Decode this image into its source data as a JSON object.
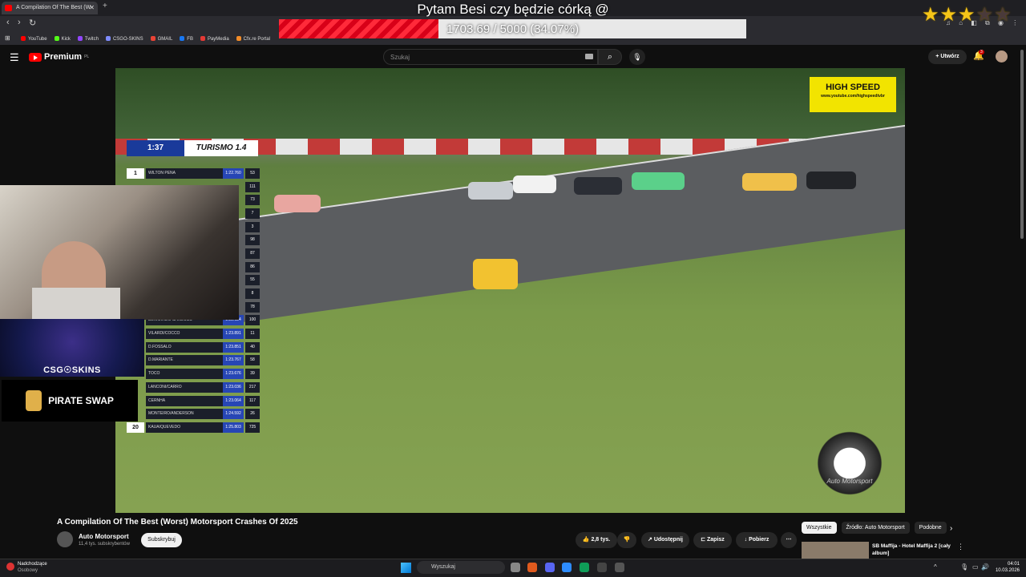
{
  "browser": {
    "tab_title": "A Compilation Of The Best (W",
    "new_tab": "+",
    "bookmarks": [
      {
        "label": "YouTube",
        "color": "#ff0000"
      },
      {
        "label": "Kick",
        "color": "#53fc18"
      },
      {
        "label": "Twitch",
        "color": "#9146ff"
      },
      {
        "label": "CSGO-SKINS",
        "color": "#7f8cff"
      },
      {
        "label": "GMAIL",
        "color": "#ea4335"
      },
      {
        "label": "FB",
        "color": "#1877f2"
      },
      {
        "label": "PayMedia",
        "color": "#e53935"
      },
      {
        "label": "Cfx.re Portal",
        "color": "#f28c28"
      }
    ]
  },
  "overlay": {
    "goal_title": "Pytam Besi czy będzie córką @",
    "goal_text": "1703.69 / 5000 (34.07%)",
    "goal_progress": 0.3407,
    "stars": {
      "filled": 3,
      "total": 5
    }
  },
  "youtube": {
    "logo_text": "Premium",
    "logo_region": "PL",
    "search_placeholder": "Szukaj",
    "create_label": "Utwórz",
    "notification_count": "3"
  },
  "video_overlay": {
    "timer": "1:37",
    "league": "TURISMO 1.4",
    "leaderboard": [
      {
        "pos": "1",
        "name": "WILTON PENA",
        "time": "1:22.760",
        "gap": "53"
      },
      {
        "pos": "",
        "name": "",
        "time": "",
        "gap": "111"
      },
      {
        "pos": "",
        "name": "",
        "time": "",
        "gap": "73"
      },
      {
        "pos": "",
        "name": "",
        "time": "",
        "gap": "7"
      },
      {
        "pos": "",
        "name": "",
        "time": "",
        "gap": "3"
      },
      {
        "pos": "",
        "name": "",
        "time": "",
        "gap": "98"
      },
      {
        "pos": "",
        "name": "",
        "time": "",
        "gap": "87"
      },
      {
        "pos": "",
        "name": "",
        "time": "",
        "gap": "86"
      },
      {
        "pos": "",
        "name": "",
        "time": "",
        "gap": "55"
      },
      {
        "pos": "",
        "name": "",
        "time": "",
        "gap": "8"
      },
      {
        "pos": "",
        "name": "",
        "time": "",
        "gap": "78"
      },
      {
        "pos": "",
        "name": "BERNARDO CARDOSO",
        "time": "1:22.634",
        "gap": "100"
      },
      {
        "pos": "",
        "name": "VILARDI/COCCO",
        "time": "1:23.891",
        "gap": "11"
      },
      {
        "pos": "",
        "name": "D.FOSSALO",
        "time": "1:23.851",
        "gap": "40"
      },
      {
        "pos": "",
        "name": "D.MARIANTE",
        "time": "1:23.767",
        "gap": "58"
      },
      {
        "pos": "",
        "name": "TOCO",
        "time": "1:23.676",
        "gap": "39"
      },
      {
        "pos": "",
        "name": "LANCONI/CARRO",
        "time": "1:23.036",
        "gap": "217"
      },
      {
        "pos": "",
        "name": "CERNHA",
        "time": "1:23.064",
        "gap": "117"
      },
      {
        "pos": "",
        "name": "MONTEIRO/ANDERSON",
        "time": "1:24.592",
        "gap": "26"
      },
      {
        "pos": "20",
        "name": "KAUA/QUEVEDO",
        "time": "1:25.803",
        "gap": "725"
      }
    ],
    "sponsor_logo": "HIGH SPEED",
    "sponsor_url": "www.youtube.com/highspeedtvbr",
    "channel_watermark": "Auto Motorsport"
  },
  "stream_overlays": {
    "csgo_label": "CSG☉SKINS",
    "pirate_label": "PIRATE SWAP"
  },
  "video": {
    "title": "A Compilation Of The Best (Worst) Motorsport Crashes Of 2025",
    "channel": "Auto Motorsport",
    "subscribers": "11,4 tys. subskrybentów",
    "subscribe_label": "Subskrybuj",
    "likes": "2,8 tys.",
    "share_label": "Udostępnij",
    "save_label": "Zapisz",
    "download_label": "Pobierz"
  },
  "sidebar": {
    "chips": [
      "Wszystkie",
      "Źródło: Auto Motorsport",
      "Podobne"
    ],
    "recommended_title": "SB Maffija - Hotel Maffija 2 [cały album]"
  },
  "taskbar": {
    "weather_title": "Nadchodzące",
    "weather_sub": "Osobowy",
    "search_label": "Wyszukaj",
    "time": "04:01",
    "date": "10.03.2026"
  }
}
